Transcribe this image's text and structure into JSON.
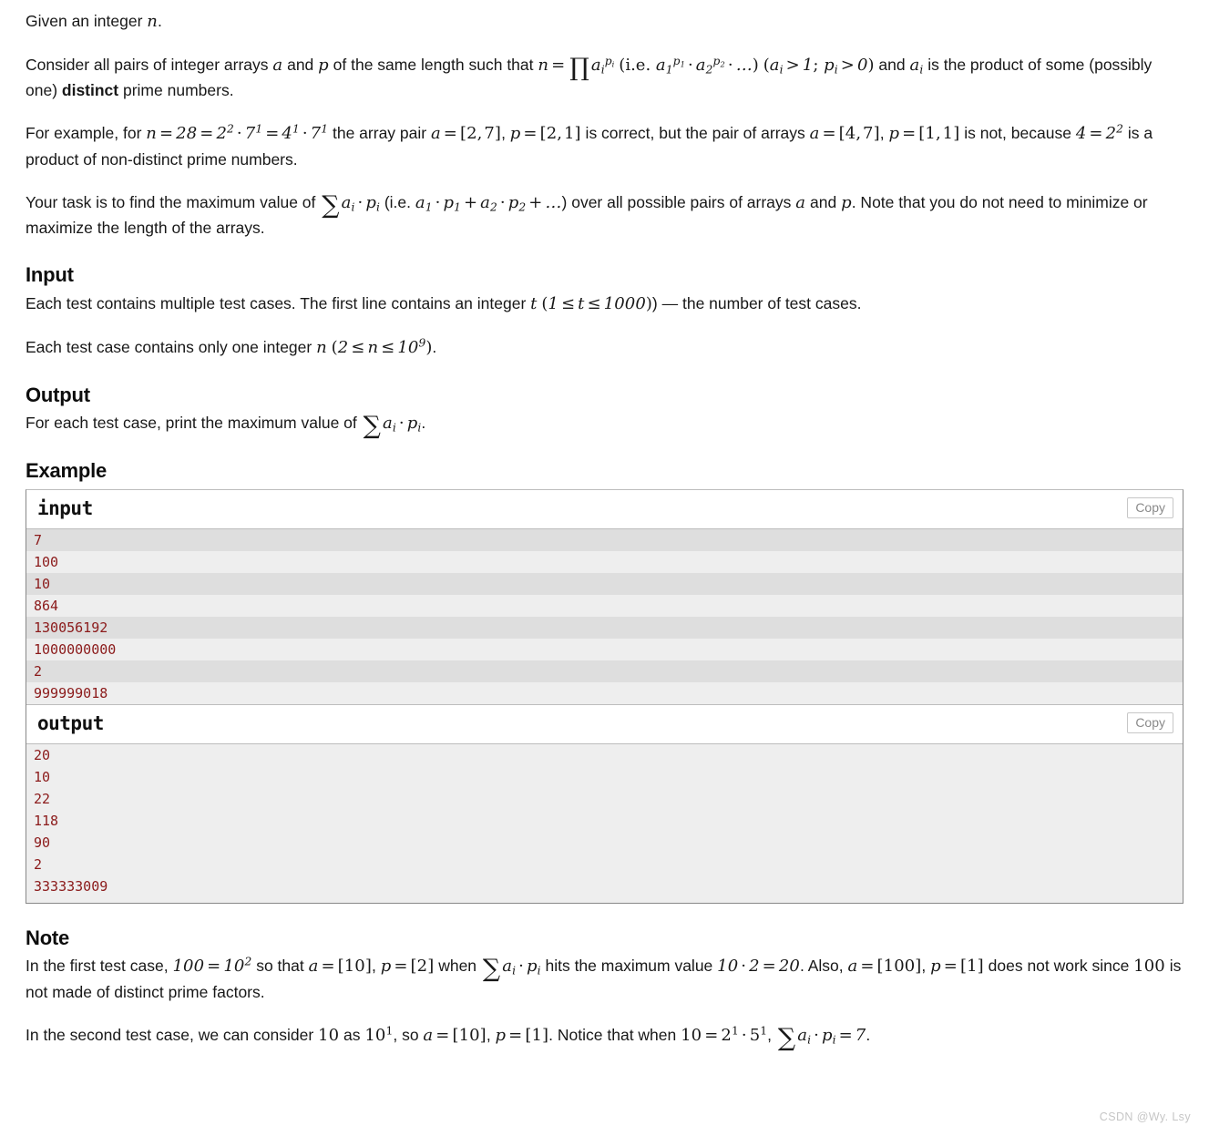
{
  "statement": {
    "p1_prefix": "Given an integer ",
    "p1_var": "n",
    "p1_suffix": ".",
    "p2_a": "Consider all pairs of integer arrays ",
    "p2_var_a": "a",
    "p2_b": " and ",
    "p2_var_p": "p",
    "p2_c": " of the same length such that ",
    "p2_formula": "n = ∏ a_i^{p_i} (i.e. a_1^{p1} · a_2^{p2} · …) (a_i > 1; p_i > 0)",
    "p2_d": " and ",
    "p2_var_ai": "a_i",
    "p2_e": " is the product of some (possibly one) ",
    "p2_bold": "distinct",
    "p2_f": " prime numbers.",
    "p3_a": "For example, for ",
    "p3_formula1": "n = 28 = 2^2 · 7^1 = 4^1 · 7^1",
    "p3_b": " the array pair ",
    "p3_formula2": "a = [2,7]",
    "p3_c": ", ",
    "p3_formula3": "p = [2,1]",
    "p3_d": " is correct, but the pair of arrays ",
    "p3_formula4": "a = [4,7]",
    "p3_e": ", ",
    "p3_formula5": "p = [1,1]",
    "p3_f": " is not, because ",
    "p3_formula6": "4 = 2^2",
    "p3_g": " is a product of non-distinct prime numbers.",
    "p4_a": "Your task is to find the maximum value of ",
    "p4_formula": "∑ a_i · p_i",
    "p4_b": " (i.e. ",
    "p4_formula2": "a_1 · p_1 + a_2 · p_2 + …",
    "p4_c": ") over all possible pairs of arrays ",
    "p4_var_a": "a",
    "p4_d": " and ",
    "p4_var_p": "p",
    "p4_e": ". Note that you do not need to minimize or maximize the length of the arrays."
  },
  "input_section": {
    "heading": "Input",
    "p1_a": "Each test contains multiple test cases. The first line contains an integer ",
    "p1_var_t": "t",
    "p1_b": " (",
    "p1_range": "1 ≤ t ≤ 1000",
    "p1_c": ") — the number of test cases.",
    "p2_a": "Each test case contains only one integer ",
    "p2_var_n": "n",
    "p2_b": " (",
    "p2_range": "2 ≤ n ≤ 10^9",
    "p2_c": ")."
  },
  "output_section": {
    "heading": "Output",
    "p1_a": "For each test case, print the maximum value of ",
    "p1_formula": "∑ a_i · p_i",
    "p1_b": "."
  },
  "example": {
    "heading": "Example",
    "input_label": "input",
    "output_label": "output",
    "copy_label": "Copy",
    "input_lines": [
      "7",
      "100",
      "10",
      "864",
      "130056192",
      "1000000000",
      "2",
      "999999018"
    ],
    "output_lines": [
      "20",
      "10",
      "22",
      "118",
      "90",
      "2",
      "333333009"
    ]
  },
  "note_section": {
    "heading": "Note",
    "p1_a": "In the first test case, ",
    "p1_f1": "100 = 10^2",
    "p1_b": " so that ",
    "p1_f2": "a = [10]",
    "p1_c": ", ",
    "p1_f3": "p = [2]",
    "p1_d": " when ",
    "p1_f4": "∑ a_i · p_i",
    "p1_e": " hits the maximum value ",
    "p1_f5": "10 · 2 = 20",
    "p1_f": ". Also, ",
    "p1_f6": "a = [100]",
    "p1_g": ", ",
    "p1_f7": "p = [1]",
    "p1_h": " does not work since ",
    "p1_f8": "100",
    "p1_i": " is not made of distinct prime factors.",
    "p2_a": "In the second test case, we can consider ",
    "p2_f1": "10",
    "p2_b": " as ",
    "p2_f2": "10^1",
    "p2_c": ", so ",
    "p2_f3": "a = [10]",
    "p2_d": ", ",
    "p2_f4": "p = [1]",
    "p2_e": ". Notice that when ",
    "p2_f5": "10 = 2^1 · 5^1",
    "p2_f": ", ",
    "p2_f6": "∑ a_i · p_i = 7",
    "p2_g": "."
  },
  "watermark": {
    "text": "CSDN @Wy. Lsy"
  },
  "colors": {
    "code_text": "#8b1a1a",
    "zebra_dark": "#dedede",
    "zebra_light": "#eeeeee",
    "border": "#888888"
  }
}
